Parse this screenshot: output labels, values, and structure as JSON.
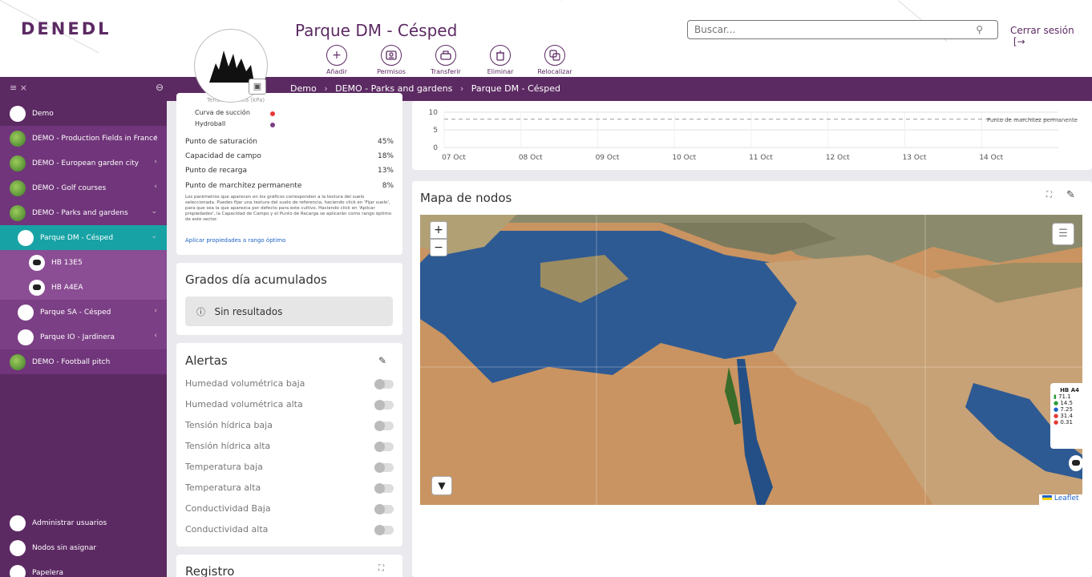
{
  "header": {
    "logo": "DENEDL",
    "title": "Parque DM - Césped",
    "actions": [
      {
        "label": "Añadir",
        "icon": "plus-icon"
      },
      {
        "label": "Permisos",
        "icon": "permissions-icon"
      },
      {
        "label": "Transferir",
        "icon": "transfer-icon"
      },
      {
        "label": "Eliminar",
        "icon": "trash-icon"
      },
      {
        "label": "Relocalizar",
        "icon": "relocate-icon"
      }
    ],
    "search_placeholder": "Buscar...",
    "logout": "Cerrar sesión"
  },
  "breadcrumb": [
    "Demo",
    "DEMO - Parks and gardens",
    "Parque DM - Césped"
  ],
  "sidebar": {
    "items": [
      {
        "label": "Demo",
        "level": 0
      },
      {
        "label": "DEMO - Production Fields in France",
        "level": 1
      },
      {
        "label": "DEMO - European garden city",
        "level": 1
      },
      {
        "label": "DEMO - Golf courses",
        "level": 1
      },
      {
        "label": "DEMO - Parks and gardens",
        "level": 1
      },
      {
        "label": "Parque DM - Césped",
        "level": 2,
        "active": true
      },
      {
        "label": "HB 13E5",
        "level": 3
      },
      {
        "label": "HB A4EA",
        "level": 3
      },
      {
        "label": "Parque SA - Césped",
        "level": 2
      },
      {
        "label": "Parque IO - Jardinera",
        "level": 2
      },
      {
        "label": "DEMO - Football pitch",
        "level": 1
      }
    ],
    "bottom": [
      {
        "label": "Administrar usuarios",
        "icon": "users-icon"
      },
      {
        "label": "Nodos sin asignar",
        "icon": "nodes-icon"
      },
      {
        "label": "Papelera",
        "icon": "trash-icon"
      }
    ]
  },
  "soil": {
    "top_cut": "Tensión hídrica (kPa)",
    "legend": [
      {
        "label": "Curva de succión",
        "color": "#e53935"
      },
      {
        "label": "Hydroball",
        "color": "#7b3f85"
      }
    ],
    "params": [
      {
        "label": "Punto de saturación",
        "value": "45%"
      },
      {
        "label": "Capacidad de campo",
        "value": "18%"
      },
      {
        "label": "Punto de recarga",
        "value": "13%"
      },
      {
        "label": "Punto de marchitez permanente",
        "value": "8%"
      }
    ],
    "note": "Los parámetros que aparecen en los gráficos corresponden a la textura del suelo seleccionada. Puedes fijar una textura del suelo de referencia, haciendo click en 'Fijar suelo', para que sea la que aparezca por defecto para este cultivo. Haciendo click en 'Aplicar propiedades', la Capacidad de Campo y el Punto de Recarga se aplicarán como rango óptimo de este sector.",
    "link": "Aplicar propiedades a rango óptimo"
  },
  "degree_days": {
    "title": "Grados día acumulados",
    "empty": "Sin resultados"
  },
  "alerts": {
    "title": "Alertas",
    "items": [
      "Humedad volumétrica baja",
      "Humedad volumétrica alta",
      "Tensión hídrica baja",
      "Tensión hídrica alta",
      "Temperatura baja",
      "Temperatura alta",
      "Conductividad Baja",
      "Conductividad alta"
    ]
  },
  "registro": {
    "title": "Registro"
  },
  "map": {
    "title": "Mapa de nodos",
    "zoom_in": "+",
    "zoom_out": "−",
    "attribution": "Leaflet",
    "popup": {
      "name": "HB A4",
      "values": [
        "71.1",
        "14.5",
        "7.25",
        "31.4",
        "0.31"
      ]
    }
  },
  "chart_data": {
    "type": "line",
    "x_ticks": [
      "07 Oct",
      "08 Oct",
      "09 Oct",
      "10 Oct",
      "11 Oct",
      "12 Oct",
      "13 Oct",
      "14 Oct"
    ],
    "y_ticks": [
      0,
      5,
      10
    ],
    "reference_line": {
      "label": "Punto de marchitez permanente",
      "value": 8
    },
    "grid": true
  }
}
